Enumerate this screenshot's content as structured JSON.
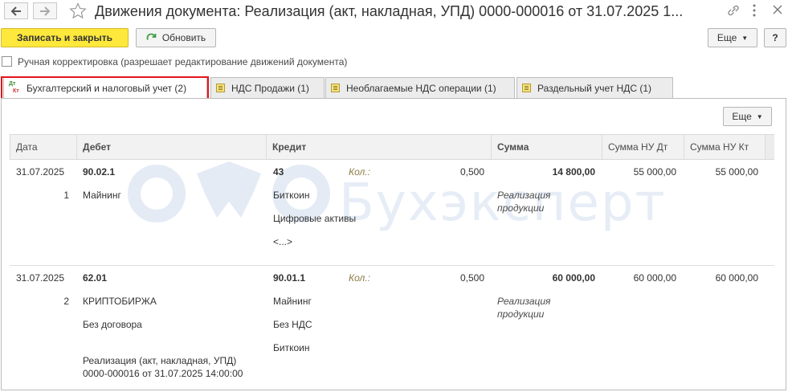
{
  "window": {
    "title": "Движения документа: Реализация (акт, накладная, УПД) 0000-000016 от 31.07.2025 1..."
  },
  "toolbar": {
    "save_close": "Записать и закрыть",
    "refresh": "Обновить",
    "more": "Еще",
    "help": "?"
  },
  "manual_edit": {
    "label": "Ручная корректировка (разрешает редактирование движений документа)",
    "checked": false
  },
  "tabs": [
    {
      "label": "Бухгалтерский и налоговый учет (2)",
      "active": true
    },
    {
      "label": "НДС Продажи (1)"
    },
    {
      "label": "Необлагаемые НДС операции (1)"
    },
    {
      "label": "Раздельный учет НДС (1)"
    }
  ],
  "tab_icon_text": {
    "top": "Дт",
    "bottom": "Кт"
  },
  "panel": {
    "more": "Еще"
  },
  "watermark": {
    "text": "Бухэксперт"
  },
  "table": {
    "columns": {
      "date": "Дата",
      "debit": "Дебет",
      "credit": "Кредит",
      "sum": "Сумма",
      "nu_dt": "Сумма НУ Дт",
      "nu_kt": "Сумма НУ Кт"
    },
    "rows": [
      {
        "date": "31.07.2025",
        "num": "1",
        "debit_account": "90.02.1",
        "debit_sub": [
          "Майнинг"
        ],
        "credit_account": "43",
        "credit_sub": [
          "Биткоин",
          "Цифровые активы",
          "<...>"
        ],
        "qty_label": "Кол.:",
        "qty": "0,500",
        "sum": "14 800,00",
        "content": "Реализация\nпродукции",
        "nu_dt": "55 000,00",
        "nu_kt": "55 000,00"
      },
      {
        "date": "31.07.2025",
        "num": "2",
        "debit_account": "62.01",
        "debit_sub": [
          "КРИПТОБИРЖА",
          "Без договора",
          "Реализация (акт, накладная, УПД)\n0000-000016 от 31.07.2025 14:00:00"
        ],
        "credit_account": "90.01.1",
        "credit_sub": [
          "Майнинг",
          "Без НДС",
          "Биткоин"
        ],
        "qty_label": "Кол.:",
        "qty": "0,500",
        "sum": "60 000,00",
        "content": "Реализация\nпродукции",
        "nu_dt": "60 000,00",
        "nu_kt": "60 000,00"
      }
    ]
  },
  "colors": {
    "primary_button": "#fee83c",
    "highlight_border": "#e3161c",
    "qty_label": "#8b7a45",
    "watermark": "#e6edf6"
  }
}
